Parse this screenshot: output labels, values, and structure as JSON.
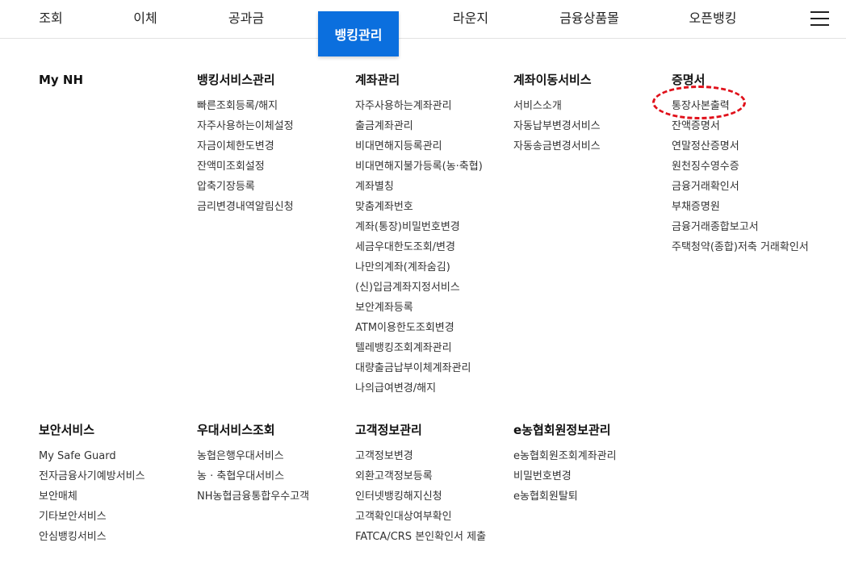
{
  "nav": {
    "items": [
      "조회",
      "이체",
      "공과금",
      "뱅킹관리",
      "라운지",
      "금융상품몰",
      "오픈뱅킹"
    ],
    "active_label": "뱅킹관리",
    "active_color": "#0b6fde",
    "menu_icon": "hamburger-menu-icon"
  },
  "sections": {
    "my_nh": {
      "title": "My NH",
      "items": []
    },
    "banking_service": {
      "title": "뱅킹서비스관리",
      "items": [
        "빠른조회등록/해지",
        "자주사용하는이체설정",
        "자금이체한도변경",
        "잔액미조회설정",
        "압축기장등록",
        "금리변경내역알림신청"
      ]
    },
    "account": {
      "title": "계좌관리",
      "items": [
        "자주사용하는계좌관리",
        "출금계좌관리",
        "비대면해지등록관리",
        "비대면해지불가등록(농·축협)",
        "계좌별칭",
        "맞춤계좌번호",
        "계좌(통장)비밀번호변경",
        "세금우대한도조회/변경",
        "나만의계좌(계좌숨김)",
        "(신)입금계좌지정서비스",
        "보안계좌등록",
        "ATM이용한도조회변경",
        "텔레뱅킹조회계좌관리",
        "대량출금납부이체계좌관리",
        "나의급여변경/해지"
      ]
    },
    "account_move": {
      "title": "계좌이동서비스",
      "items": [
        "서비스소개",
        "자동납부변경서비스",
        "자동송금변경서비스"
      ]
    },
    "certificate": {
      "title": "증명서",
      "items": [
        "통장사본출력",
        "잔액증명서",
        "연말정산증명서",
        "원천징수영수증",
        "금융거래확인서",
        "부채증명원",
        "금융거래종합보고서",
        "주택청약(종합)저축 거래확인서"
      ],
      "highlight_color": "#e0101a"
    },
    "security": {
      "title": "보안서비스",
      "items": [
        "My Safe Guard",
        "전자금융사기예방서비스",
        "보안매체",
        "기타보안서비스",
        "안심뱅킹서비스"
      ]
    },
    "preferential": {
      "title": "우대서비스조회",
      "items": [
        "농협은행우대서비스",
        "농 · 축협우대서비스",
        "NH농협금융통합우수고객"
      ]
    },
    "customer_info": {
      "title": "고객정보관리",
      "items": [
        "고객정보변경",
        "외환고객정보등록",
        "인터넷뱅킹해지신청",
        "고객확인대상여부확인",
        "FATCA/CRS 본인확인서 제출"
      ]
    },
    "e_member": {
      "title": "e농협회원정보관리",
      "items": [
        "e농협회원조회계좌관리",
        "비밀번호변경",
        "e농협회원탈퇴"
      ]
    }
  }
}
